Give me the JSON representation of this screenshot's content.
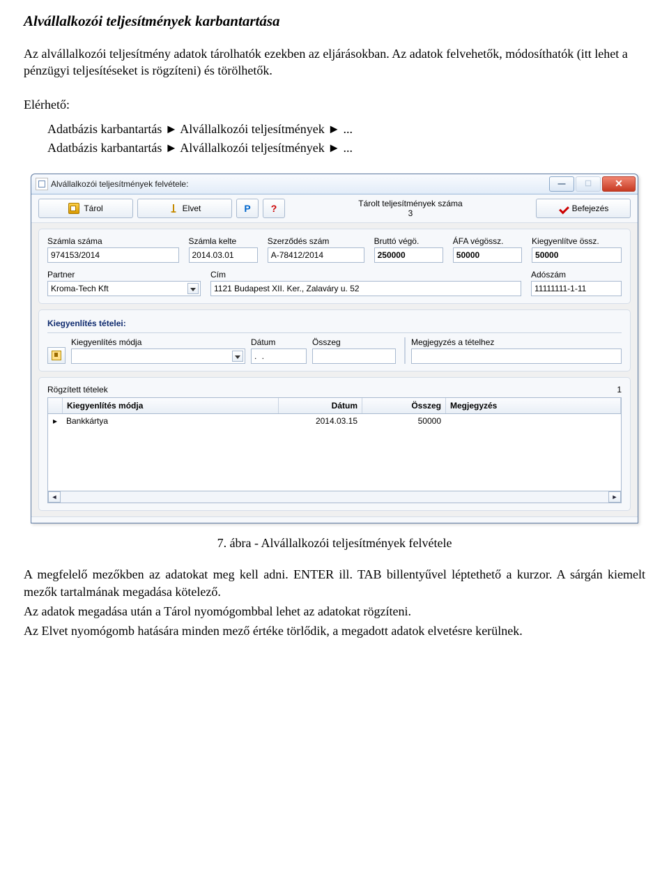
{
  "doc": {
    "title": "Alvállalkozói teljesítmények karbantartása",
    "intro": "Az alvállalkozói teljesítmény adatok tárolhatók ezekben az eljárásokban. Az adatok felvehetők, módosíthatók (itt lehet a pénzügyi teljesítéseket is rögzíteni) és törölhetők.",
    "reach_label": "Elérhető:",
    "nav1": "Adatbázis karbantartás ► Alvállalkozói teljesítmények ► ...",
    "nav2": "Adatbázis karbantartás ► Alvállalkozói teljesítmények ► ...",
    "caption": "7. ábra - Alvállalkozói teljesítmények felvétele",
    "para1": "A megfelelő mezőkben az adatokat meg kell adni. ENTER ill. TAB billentyűvel léptethető a kurzor. A sárgán kiemelt mezők tartalmának megadása kötelező.",
    "para2": "Az adatok megadása után a Tárol nyomógombbal lehet az adatokat rögzíteni.",
    "para3": "Az Elvet nyomógomb hatására minden mező értéke törlődik, a megadott adatok elvetésre kerülnek."
  },
  "window": {
    "title": "Alvállalkozói teljesítmények felvétele:",
    "toolbar": {
      "store": "Tárol",
      "discard": "Elvet",
      "p": "P",
      "help": "?",
      "stat_label": "Tárolt teljesítmények száma",
      "stat_value": "3",
      "finish": "Befejezés"
    },
    "fields": {
      "invoice_no_label": "Számla száma",
      "invoice_no": "974153/2014",
      "invoice_date_label": "Számla kelte",
      "invoice_date": "2014.03.01",
      "contract_no_label": "Szerződés szám",
      "contract_no": "A-78412/2014",
      "gross_label": "Bruttó végö.",
      "gross": "250000",
      "vat_label": "ÁFA végössz.",
      "vat": "50000",
      "paid_label": "Kiegyenlítve össz.",
      "paid": "50000",
      "partner_label": "Partner",
      "partner": "Kroma-Tech Kft",
      "address_label": "Cím",
      "address": "1121 Budapest XII. Ker., Zalaváry u. 52",
      "taxno_label": "Adószám",
      "taxno": "11111111-1-11"
    },
    "settle": {
      "section": "Kiegyenlítés tételei:",
      "mode_label": "Kiegyenlítés módja",
      "mode": "",
      "date_label": "Dátum",
      "date": ".  .",
      "amount_label": "Összeg",
      "amount": "",
      "note_label": "Megjegyzés a tételhez",
      "note": "",
      "recorded_label": "Rögzített tételek",
      "recorded_count": "1"
    },
    "grid": {
      "h_mode": "Kiegyenlítés módja",
      "h_date": "Dátum",
      "h_amount": "Összeg",
      "h_note": "Megjegyzés",
      "row1": {
        "marker": "▸",
        "mode": "Bankkártya",
        "date": "2014.03.15",
        "amount": "50000",
        "note": ""
      }
    }
  }
}
